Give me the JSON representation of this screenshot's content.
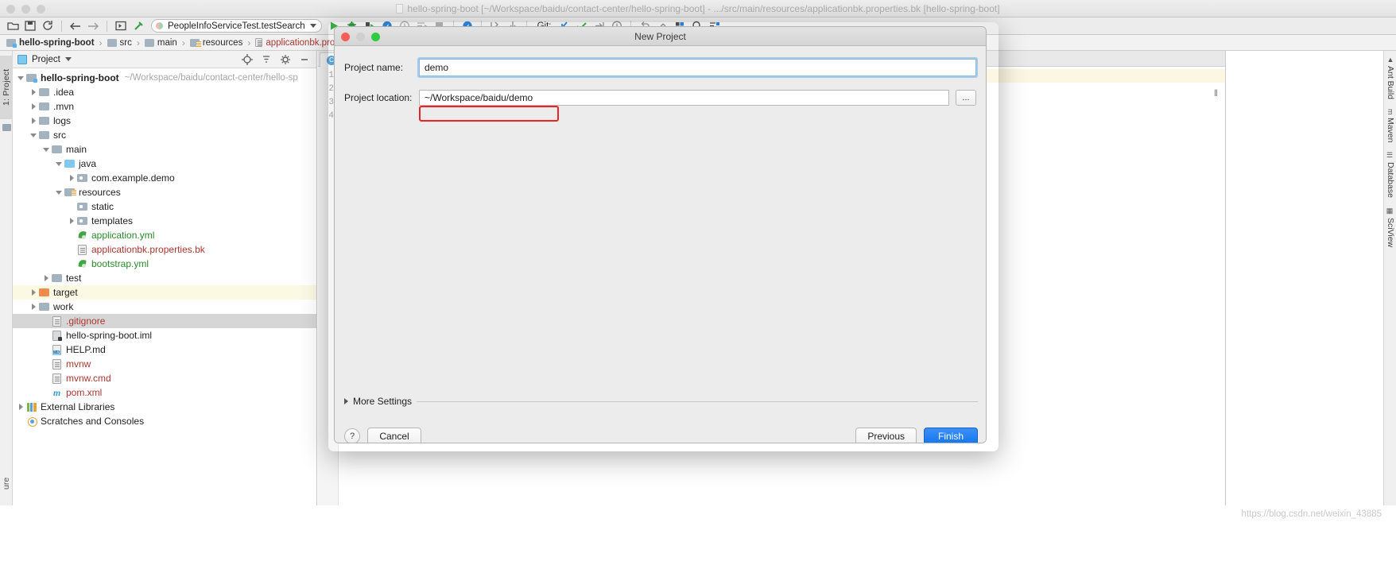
{
  "window": {
    "title": "hello-spring-boot [~/Workspace/baidu/contact-center/hello-spring-boot] - .../src/main/resources/applicationbk.properties.bk [hello-spring-boot]"
  },
  "toolbar": {
    "run_config": "PeopleInfoServiceTest.testSearch",
    "git_label": "Git:",
    "icons": [
      "open-folder-icon",
      "save-all-icon",
      "sync-icon",
      "navigate-back-icon",
      "navigate-forward-icon",
      "run-anything-icon",
      "build-hammer-icon"
    ],
    "run_icons": [
      "run-icon",
      "debug-icon",
      "run-coverage-icon",
      "profiler-icon",
      "run-with-clock-icon",
      "run-list-icon",
      "stop-icon",
      "attach-profiler-icon",
      "step-out-icon",
      "step-in-icon"
    ],
    "git_icons": [
      "update-project-icon",
      "commit-icon",
      "push-icon",
      "history-icon"
    ],
    "right_icons": [
      "undo-icon",
      "redo-icon",
      "settings-icon",
      "search-everywhere-icon",
      "structure-icon"
    ]
  },
  "breadcrumb": {
    "items": [
      {
        "label": "hello-spring-boot",
        "icon": "module-folder-icon",
        "bold": true,
        "kind": "module"
      },
      {
        "label": "src",
        "icon": "folder-icon",
        "bold": false,
        "kind": "folder"
      },
      {
        "label": "main",
        "icon": "folder-icon",
        "bold": false,
        "kind": "folder"
      },
      {
        "label": "resources",
        "icon": "resources-folder-icon",
        "bold": false,
        "kind": "resources"
      },
      {
        "label": "applicationbk.properties.bk",
        "icon": "file-icon",
        "bold": false,
        "kind": "file"
      }
    ],
    "separator": "›"
  },
  "left_strip": {
    "tab": "1: Project",
    "bottom_tab": "ure",
    "folder_icon": "folder-icon"
  },
  "project_panel": {
    "header": {
      "title": "Project",
      "dropdown_icon": "chevron-down-icon",
      "window_icon": "project-window-icon",
      "icons": [
        "locate-target-icon",
        "collapse-all-icon",
        "gear-icon",
        "hide-icon"
      ]
    },
    "tree": [
      {
        "indent": 0,
        "arrow": "down",
        "icon": "module-folder-icon",
        "label": "hello-spring-boot",
        "bold": true,
        "color": "default",
        "path": "~/Workspace/baidu/contact-center/hello-sp",
        "state": "normal"
      },
      {
        "indent": 1,
        "arrow": "right",
        "icon": "folder-icon",
        "label": ".idea",
        "bold": false,
        "color": "default",
        "path": "",
        "state": "normal"
      },
      {
        "indent": 1,
        "arrow": "right",
        "icon": "folder-icon",
        "label": ".mvn",
        "bold": false,
        "color": "default",
        "path": "",
        "state": "normal"
      },
      {
        "indent": 1,
        "arrow": "right",
        "icon": "folder-icon",
        "label": "logs",
        "bold": false,
        "color": "default",
        "path": "",
        "state": "normal"
      },
      {
        "indent": 1,
        "arrow": "down",
        "icon": "folder-icon",
        "label": "src",
        "bold": false,
        "color": "default",
        "path": "",
        "state": "normal"
      },
      {
        "indent": 2,
        "arrow": "down",
        "icon": "folder-icon",
        "label": "main",
        "bold": false,
        "color": "default",
        "path": "",
        "state": "normal"
      },
      {
        "indent": 3,
        "arrow": "down",
        "icon": "sources-folder-icon",
        "label": "java",
        "bold": false,
        "color": "default",
        "path": "",
        "state": "normal"
      },
      {
        "indent": 4,
        "arrow": "right",
        "icon": "package-icon",
        "label": "com.example.demo",
        "bold": false,
        "color": "default",
        "path": "",
        "state": "normal"
      },
      {
        "indent": 3,
        "arrow": "down",
        "icon": "resources-folder-icon",
        "label": "resources",
        "bold": false,
        "color": "default",
        "path": "",
        "state": "normal"
      },
      {
        "indent": 4,
        "arrow": "none",
        "icon": "package-icon",
        "label": "static",
        "bold": false,
        "color": "default",
        "path": "",
        "state": "normal"
      },
      {
        "indent": 4,
        "arrow": "right",
        "icon": "package-icon",
        "label": "templates",
        "bold": false,
        "color": "default",
        "path": "",
        "state": "normal"
      },
      {
        "indent": 4,
        "arrow": "none",
        "icon": "yaml-spring-icon",
        "label": "application.yml",
        "bold": false,
        "color": "green",
        "path": "",
        "state": "normal"
      },
      {
        "indent": 4,
        "arrow": "none",
        "icon": "properties-file-icon",
        "label": "applicationbk.properties.bk",
        "bold": false,
        "color": "red",
        "path": "",
        "state": "normal"
      },
      {
        "indent": 4,
        "arrow": "none",
        "icon": "yaml-spring-icon",
        "label": "bootstrap.yml",
        "bold": false,
        "color": "green",
        "path": "",
        "state": "normal"
      },
      {
        "indent": 2,
        "arrow": "right",
        "icon": "folder-icon",
        "label": "test",
        "bold": false,
        "color": "default",
        "path": "",
        "state": "normal"
      },
      {
        "indent": 1,
        "arrow": "right",
        "icon": "excluded-folder-icon",
        "label": "target",
        "bold": false,
        "color": "default",
        "path": "",
        "state": "highlight"
      },
      {
        "indent": 1,
        "arrow": "right",
        "icon": "folder-icon",
        "label": "work",
        "bold": false,
        "color": "default",
        "path": "",
        "state": "normal"
      },
      {
        "indent": 2,
        "arrow": "none",
        "icon": "file-icon",
        "label": ".gitignore",
        "bold": false,
        "color": "red",
        "path": "",
        "state": "selected"
      },
      {
        "indent": 2,
        "arrow": "none",
        "icon": "iml-file-icon",
        "label": "hello-spring-boot.iml",
        "bold": false,
        "color": "default",
        "path": "",
        "state": "normal"
      },
      {
        "indent": 2,
        "arrow": "none",
        "icon": "markdown-file-icon",
        "label": "HELP.md",
        "bold": false,
        "color": "default",
        "path": "",
        "state": "normal"
      },
      {
        "indent": 2,
        "arrow": "none",
        "icon": "file-icon",
        "label": "mvnw",
        "bold": false,
        "color": "red",
        "path": "",
        "state": "normal"
      },
      {
        "indent": 2,
        "arrow": "none",
        "icon": "file-icon",
        "label": "mvnw.cmd",
        "bold": false,
        "color": "red",
        "path": "",
        "state": "normal"
      },
      {
        "indent": 2,
        "arrow": "none",
        "icon": "maven-file-icon",
        "label": "pom.xml",
        "bold": false,
        "color": "red",
        "path": "",
        "state": "normal"
      },
      {
        "indent": 0,
        "arrow": "right",
        "icon": "external-libraries-icon",
        "label": "External Libraries",
        "bold": false,
        "color": "default",
        "path": "",
        "state": "normal"
      },
      {
        "indent": 0,
        "arrow": "none",
        "icon": "scratches-icon",
        "label": "Scratches and Consoles",
        "bold": false,
        "color": "default",
        "path": "",
        "state": "normal"
      }
    ]
  },
  "editor": {
    "tab_label": "C",
    "tab_icon": "class-file-icon",
    "line_numbers": [
      "1",
      "2",
      "3",
      "4"
    ],
    "caret_marker": "‖"
  },
  "right_strip": {
    "tabs": [
      "Ant Build",
      "Maven",
      "Database",
      "SciView"
    ],
    "icons": [
      "ant-icon",
      "maven-icon",
      "database-icon",
      "sciview-icon"
    ]
  },
  "dialog": {
    "title": "New Project",
    "traffic_lights": [
      "close-red",
      "minimize-gray",
      "zoom-green"
    ],
    "project_name": {
      "label": "Project name:",
      "value": "demo",
      "placeholder": ""
    },
    "project_location": {
      "label": "Project location:",
      "value": "~/Workspace/baidu/demo",
      "placeholder": "",
      "browse_label": "..."
    },
    "more_settings": {
      "label": "More Settings",
      "arrow_icon": "chevron-right-icon"
    },
    "buttons": {
      "help": "?",
      "cancel": "Cancel",
      "previous": "Previous",
      "finish": "Finish"
    },
    "highlight_color": "#ee2222",
    "primary_color": "#1277ef"
  },
  "watermark": "https://blog.csdn.net/weixin_43885"
}
